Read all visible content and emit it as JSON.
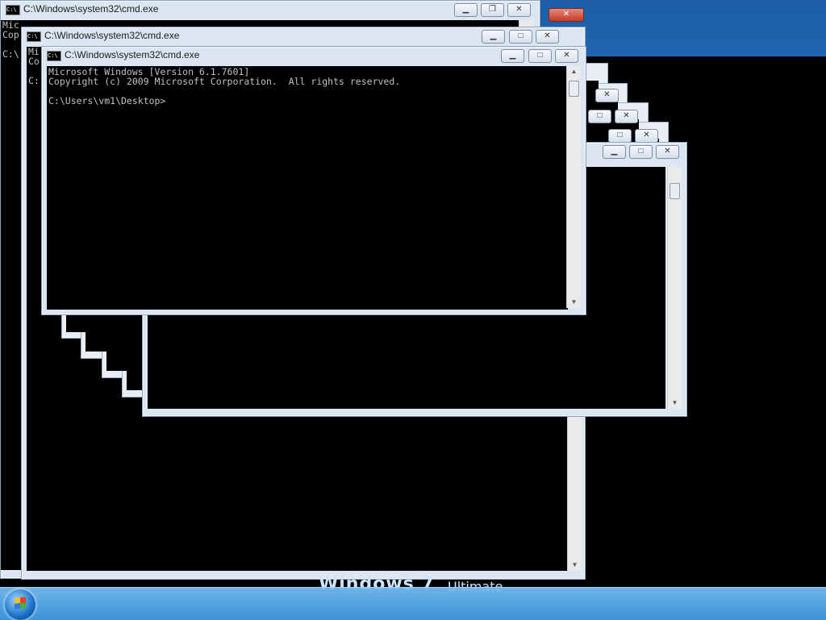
{
  "windows": [
    {
      "title": "C:\\Windows\\system32\\cmd.exe",
      "lines": "Mic\nCop\n\nC:\\"
    },
    {
      "title": "C:\\Windows\\system32\\cmd.exe",
      "lines": "Mi\nCo\n\nC:"
    },
    {
      "title": "C:\\Windows\\system32\\cmd.exe",
      "lines": "Microsoft Windows [Version 6.1.7601]\nCopyright (c) 2009 Microsoft Corporation.  All rights reserved.\n\nC:\\Users\\vm1\\Desktop>"
    }
  ],
  "title_buttons": {
    "minimize": "▁",
    "maximize": "□",
    "restore": "❐",
    "close": "✕"
  },
  "scroll": {
    "up": "▲",
    "down": "▼"
  },
  "wallpaper": {
    "brand": "Windows",
    "edition": "Ultimate",
    "version": "7"
  },
  "icons": {
    "console": "C:\\"
  }
}
